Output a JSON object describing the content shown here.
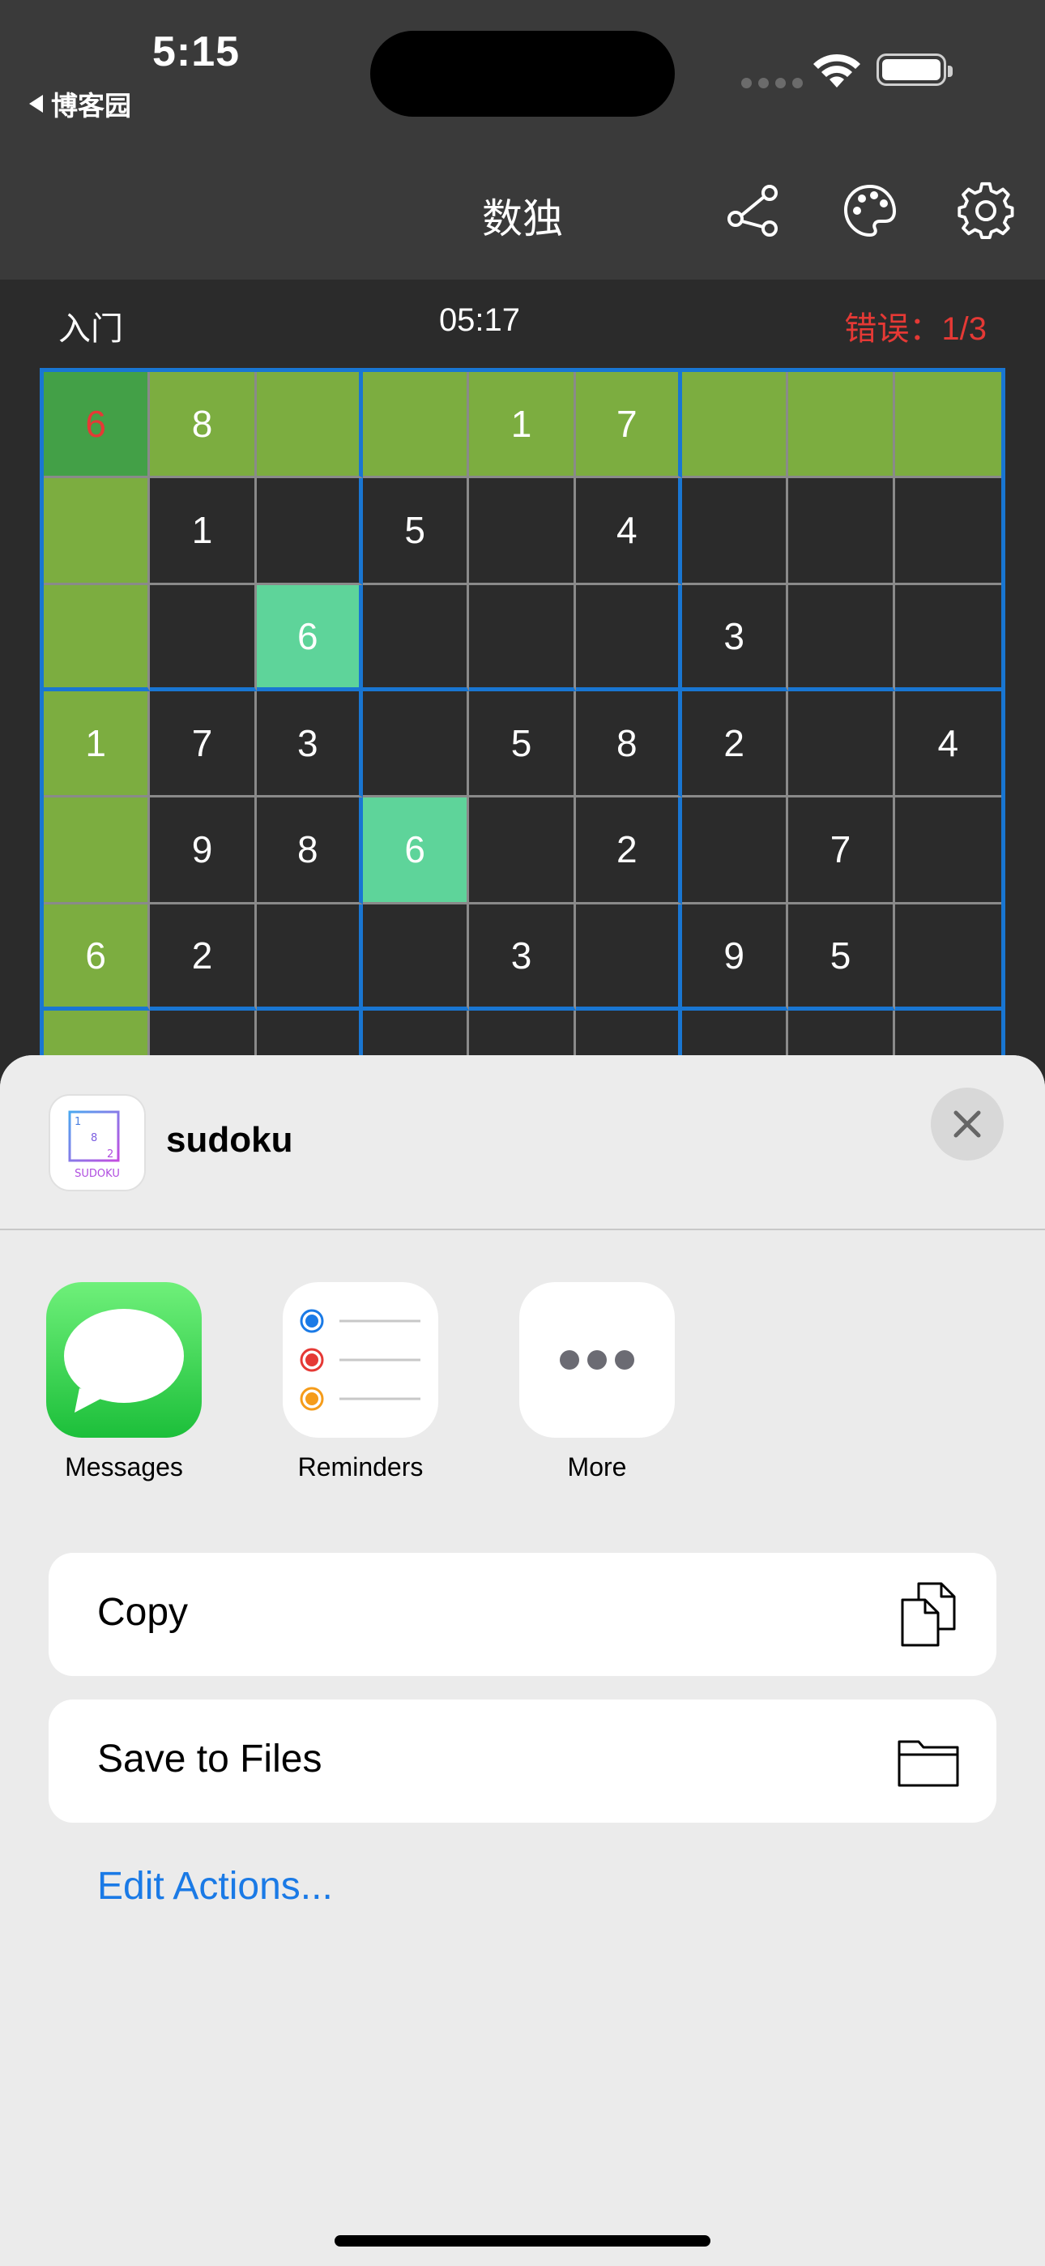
{
  "status": {
    "time": "5:15",
    "back_app": "博客园"
  },
  "nav": {
    "title": "数独",
    "icons": [
      "share-icon",
      "palette-icon",
      "gear-icon"
    ]
  },
  "game": {
    "difficulty": "入门",
    "timer": "05:17",
    "errors": "错误：1/3"
  },
  "board": {
    "rows": [
      [
        "6",
        "8",
        "",
        "",
        "1",
        "7",
        "",
        "",
        ""
      ],
      [
        "",
        "1",
        "",
        "5",
        "",
        "4",
        "",
        "",
        ""
      ],
      [
        "",
        "",
        "6",
        "",
        "",
        "",
        "3",
        "",
        ""
      ],
      [
        "1",
        "7",
        "3",
        "",
        "5",
        "8",
        "2",
        "",
        "4"
      ],
      [
        "",
        "9",
        "8",
        "6",
        "",
        "2",
        "",
        "7",
        ""
      ],
      [
        "6",
        "2",
        "",
        "",
        "3",
        "",
        "9",
        "5",
        ""
      ],
      [
        "",
        "",
        "",
        "",
        "",
        "",
        "",
        "",
        ""
      ],
      [
        "",
        "",
        "",
        "",
        "",
        "",
        "",
        "",
        ""
      ],
      [
        "",
        "",
        "",
        "",
        "",
        "",
        "",
        "",
        ""
      ]
    ],
    "selected": "row 1, column 1",
    "selected_value_status": "error",
    "highlighted_row": 1,
    "highlighted_column": 1,
    "same_number_cells": [
      "row 3, column 3",
      "row 5, column 4"
    ]
  },
  "sheet": {
    "app_name": "sudoku",
    "app_icon_digits": [
      "1",
      "8",
      "2"
    ],
    "app_icon_caption": "SUDOKU",
    "apps": [
      {
        "label": "Messages",
        "icon": "messages-icon"
      },
      {
        "label": "Reminders",
        "icon": "reminders-icon"
      },
      {
        "label": "More",
        "icon": "more-icon"
      }
    ],
    "actions": [
      {
        "label": "Copy",
        "icon": "copy-icon"
      },
      {
        "label": "Save to Files",
        "icon": "folder-icon"
      }
    ],
    "edit_actions": "Edit Actions..."
  },
  "colors": {
    "accent_blue": "#1976d2",
    "highlight_green": "#7cad40",
    "selected_green": "#43a047",
    "same_number": "#5ed49a",
    "error_red": "#e53935",
    "link_blue": "#1a7ae6"
  }
}
